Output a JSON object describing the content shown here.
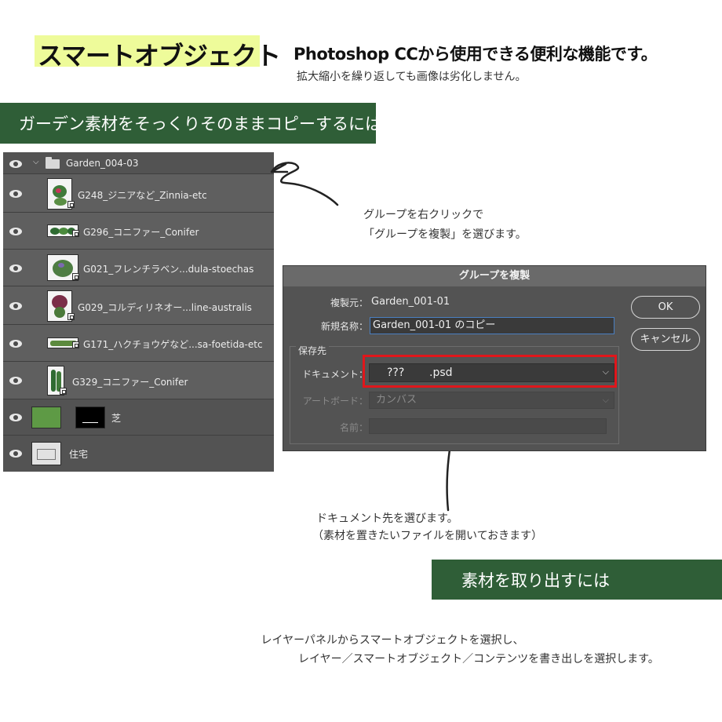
{
  "header": {
    "title": "スマートオブジェクト",
    "headline": "Photoshop CCから使用できる便利な機能です。",
    "subline": "拡大縮小を繰り返しても画像は劣化しません。"
  },
  "banners": {
    "garden_copy": "ガーデン素材をそっくりそのままコピーするには",
    "extract": "素材を取り出すには"
  },
  "layers_panel": {
    "group_name": "Garden_004-03",
    "layers": [
      {
        "name": "G248_ジニアなど_Zinnia-etc"
      },
      {
        "name": "G296_コニファー_Conifer"
      },
      {
        "name": "G021_フレンチラベン...dula-stoechas"
      },
      {
        "name": "G029_コルディリネオー...line-australis"
      },
      {
        "name": "G171_ハクチョウゲなど...sa-foetida-etc"
      },
      {
        "name": "G329_コニファー_Conifer"
      }
    ],
    "lawn_layer": "芝",
    "house_layer": "住宅"
  },
  "annotations": {
    "right_click_line1": "グループを右クリックで",
    "right_click_line2": "「グループを複製」を選びます。",
    "doc_line1": "ドキュメント先を選びます。",
    "doc_line2": "（素材を置きたいファイルを開いておきます）",
    "extract_line1": "レイヤーパネルからスマートオブジェクトを選択し、",
    "extract_line2": "レイヤー／スマートオブジェクト／コンテンツを書き出しを選択します。"
  },
  "dialog": {
    "title": "グループを複製",
    "source_label": "複製元：",
    "source_value": "Garden_001-01",
    "new_name_label": "新規名称：",
    "new_name_value": "Garden_001-01 のコピー",
    "destination_label": "保存先",
    "document_label": "ドキュメント：",
    "document_value_1": "???",
    "document_value_2": ".psd",
    "artboard_label": "アートボード：",
    "artboard_value": "カンバス",
    "name_label": "名前：",
    "ok_label": "OK",
    "cancel_label": "キャンセル"
  },
  "colors": {
    "banner_green": "#2f5e37",
    "title_highlight": "#eefb9a",
    "panel_gray": "#535353",
    "highlight_red": "#e0161b"
  }
}
